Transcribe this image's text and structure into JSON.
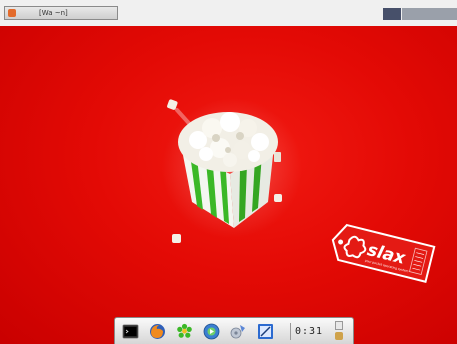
{
  "taskbar_top": {
    "task_label": "[Wa  ~n]",
    "pagers": [
      "workspace-1",
      "workspace-2"
    ]
  },
  "desktop": {
    "wallpaper_color": "#e30a05",
    "logo_text": "slax",
    "logo_subtext": "your pocket operating system"
  },
  "dock": {
    "icons": [
      "terminal-icon",
      "firefox-icon",
      "icq-icon",
      "media-player-icon",
      "kde-settings-icon",
      "text-editor-icon"
    ],
    "clock": "0:31"
  },
  "colors": {
    "accent_red": "#e30a05",
    "popcorn_green": "#3bb827",
    "panel_bg": "#f0f0f0"
  }
}
